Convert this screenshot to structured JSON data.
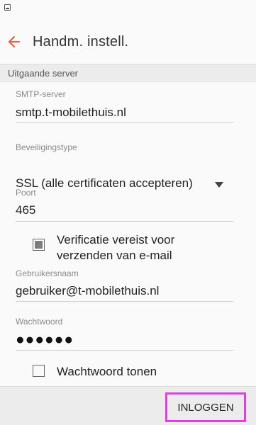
{
  "statusbar": {
    "icon": "image-icon"
  },
  "appbar": {
    "back_icon": "arrow-left-icon",
    "title": "Handm. instell."
  },
  "section": {
    "header": "Uitgaande server"
  },
  "smtp": {
    "label": "SMTP-server",
    "value": "smtp.t-mobilethuis.nl"
  },
  "security": {
    "label": "Beveiligingstype",
    "value": "SSL (alle certificaten accepteren)"
  },
  "port": {
    "label": "Poort",
    "value": "465"
  },
  "auth": {
    "label_line1": "Verificatie vereist voor",
    "label_line2": "verzenden van e-mail",
    "checked": true
  },
  "username": {
    "label": "Gebruikersnaam",
    "value": "gebruiker@t-mobilethuis.nl"
  },
  "password": {
    "label": "Wachtwoord",
    "value": "●●●●●●"
  },
  "show_password": {
    "label": "Wachtwoord tonen",
    "checked": false
  },
  "actions": {
    "login": "INLOGGEN"
  },
  "colors": {
    "accent": "#f05a3a",
    "highlight": "#e040e0"
  }
}
